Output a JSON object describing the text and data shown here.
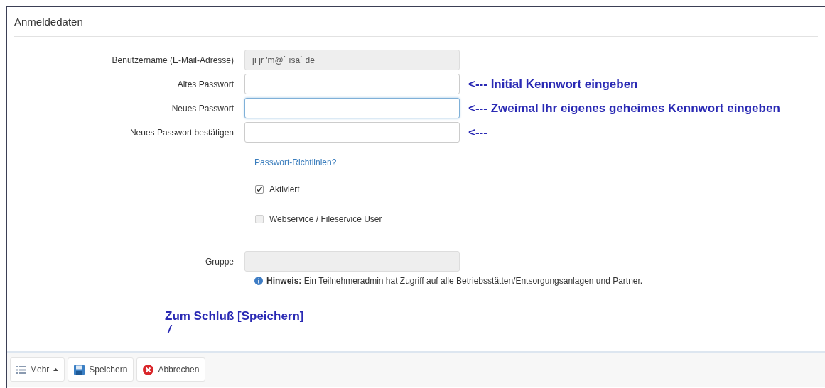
{
  "panel": {
    "title": "Anmeldedaten"
  },
  "fields": [
    {
      "label": "Benutzername (E-Mail-Adresse)",
      "value": "jı  ȷr  'm@`  ısa`  de",
      "disabled": true,
      "focused": false
    },
    {
      "label": "Altes Passwort",
      "disabled": false,
      "focused": false,
      "note": "<--- Initial Kennwort eingeben"
    },
    {
      "label": "Neues Passwort",
      "disabled": false,
      "focused": true,
      "note": "<--- Zweimal Ihr eigenes geheimes Kennwort eingeben"
    },
    {
      "label": "Neues Passwort bestätigen",
      "disabled": false,
      "focused": false,
      "note": "<---"
    }
  ],
  "policy_link": "Passwort-Richtlinien?",
  "checkboxes": [
    {
      "label": "Aktiviert",
      "checked": true,
      "disabled": false
    },
    {
      "label": "Webservice / Fileservice User",
      "checked": false,
      "disabled": true
    }
  ],
  "group": {
    "label": "Gruppe",
    "disabled": true
  },
  "hint": {
    "text": "**Hinweis:** Ein Teilnehmeradmin hat Zugriff auf alle Betriebsstätten/Entsorgungsanlagen und Partner."
  },
  "save_note": {
    "text": "Zum Schluß [Speichern]",
    "pointer": "/"
  },
  "toolbar": [
    {
      "kind": "menu",
      "label": "Mehr"
    },
    {
      "kind": "save",
      "label": "Speichern"
    },
    {
      "kind": "cancel",
      "label": "Abbrechen"
    }
  ]
}
